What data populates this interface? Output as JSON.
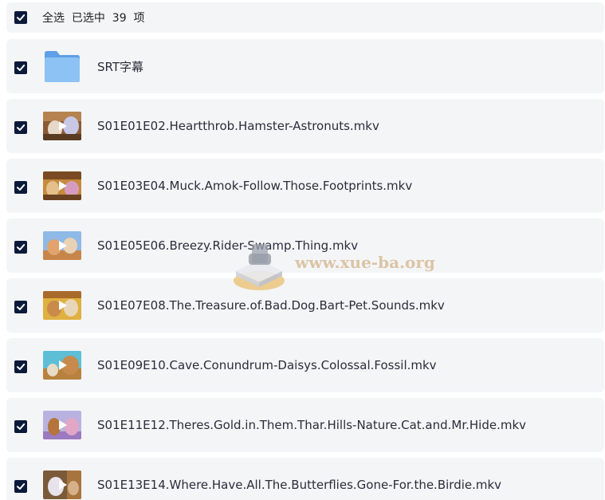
{
  "header": {
    "select_all_text": "全选  已选中  39  项",
    "checked": true
  },
  "files": [
    {
      "name": "SRT字幕",
      "type": "folder",
      "checked": true,
      "icon": "folder-icon"
    },
    {
      "name": "S01E01E02.Heartthrob.Hamster-Astronuts.mkv",
      "type": "video",
      "checked": true,
      "icon": "video-thumbnail"
    },
    {
      "name": "S01E03E04.Muck.Amok-Follow.Those.Footprints.mkv",
      "type": "video",
      "checked": true,
      "icon": "video-thumbnail"
    },
    {
      "name": "S01E05E06.Breezy.Rider-Swamp.Thing.mkv",
      "type": "video",
      "checked": true,
      "icon": "video-thumbnail"
    },
    {
      "name": "S01E07E08.The.Treasure.of.Bad.Dog.Bart-Pet.Sounds.mkv",
      "type": "video",
      "checked": true,
      "icon": "video-thumbnail"
    },
    {
      "name": "S01E09E10.Cave.Conundrum-Daisys.Colossal.Fossil.mkv",
      "type": "video",
      "checked": true,
      "icon": "video-thumbnail"
    },
    {
      "name": "S01E11E12.Theres.Gold.in.Them.Thar.Hills-Nature.Cat.and.Mr.Hide.mkv",
      "type": "video",
      "checked": true,
      "icon": "video-thumbnail"
    },
    {
      "name": "S01E13E14.Where.Have.All.The.Butterflies.Gone-For.the.Birdie.mkv",
      "type": "video",
      "checked": true,
      "icon": "video-thumbnail"
    }
  ],
  "watermark": {
    "text": "www.xue-ba.org"
  },
  "colors": {
    "checkbox": "#0c1a3a",
    "row_bg": "#f4f5f7",
    "folder": "#7fb7f0"
  }
}
